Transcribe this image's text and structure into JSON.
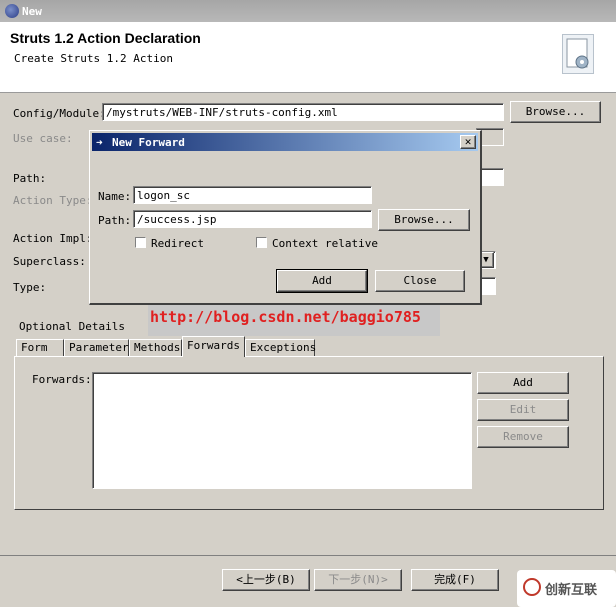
{
  "window": {
    "title": "New"
  },
  "banner": {
    "heading": "Struts 1.2 Action Declaration",
    "subtitle": "Create Struts 1.2 Action"
  },
  "form": {
    "config_label": "Config/Module:",
    "config_value": "/mystruts/WEB-INF/struts-config.xml",
    "browse_label": "Browse...",
    "usecase_label": "Use case:",
    "path_label": "Path:",
    "action_type_label": "Action Type:",
    "action_impl_label": "Action Impl:",
    "superclass_label": "Superclass:",
    "type_label": "Type:"
  },
  "optional": {
    "label": "Optional Details",
    "tabs": [
      "Form",
      "Parameter",
      "Methods",
      "Forwards",
      "Exceptions"
    ],
    "active_tab": "Forwards",
    "forwards_label": "Forwards:",
    "add_label": "Add",
    "edit_label": "Edit",
    "remove_label": "Remove"
  },
  "dialog": {
    "title": "New Forward",
    "name_label": "Name:",
    "name_value": "logon_sc",
    "path_label": "Path:",
    "path_value": "/success.jsp",
    "browse_label": "Browse...",
    "redirect_label": "Redirect",
    "context_label": "Context relative",
    "add_label": "Add",
    "close_label": "Close",
    "close_x": "✕"
  },
  "footer": {
    "back_label": "<上一步(B)",
    "next_label": "下一步(N)>",
    "finish_label": "完成(F)"
  },
  "watermark": {
    "text": "http://blog.csdn.net/baggio785"
  },
  "brand": {
    "text": "创新互联"
  }
}
